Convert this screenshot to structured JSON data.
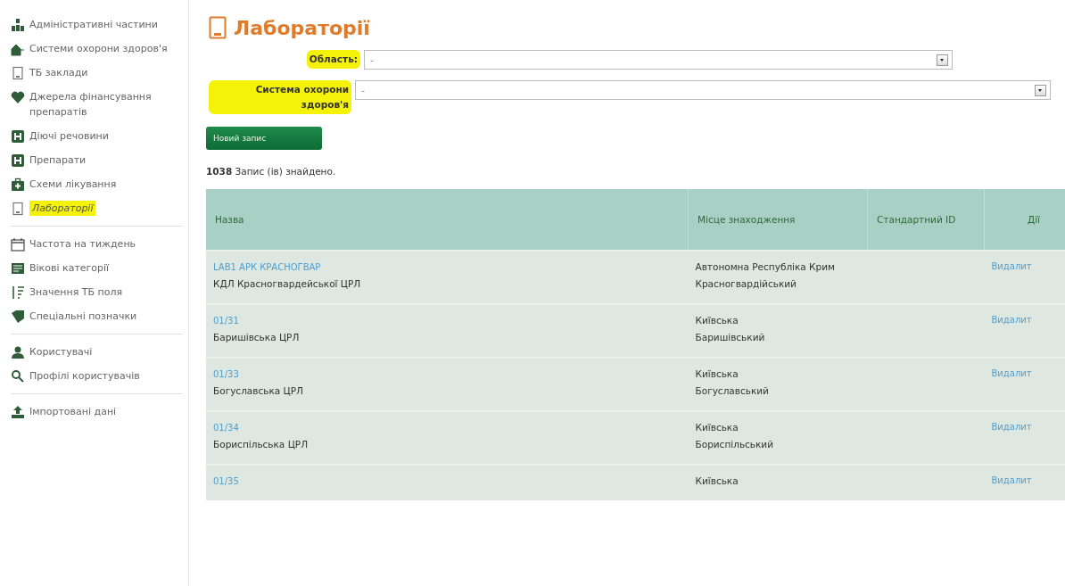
{
  "sidebar": {
    "groups": [
      {
        "items": [
          {
            "label": "Адміністративні частини",
            "selected": false
          },
          {
            "label": "Системи охорони здоров'я",
            "selected": false
          },
          {
            "label": "ТБ заклади",
            "selected": false
          },
          {
            "label": "Джерела фінансування препаратів",
            "selected": false
          },
          {
            "label": "Діючі речовини",
            "selected": false
          },
          {
            "label": "Препарати",
            "selected": false
          },
          {
            "label": "Схеми лікування",
            "selected": false
          },
          {
            "label": "Лабораторії",
            "selected": true
          }
        ]
      },
      {
        "items": [
          {
            "label": "Частота на тиждень",
            "selected": false
          },
          {
            "label": "Вікові категорії",
            "selected": false
          },
          {
            "label": "Значення ТБ поля",
            "selected": false
          },
          {
            "label": "Спеціальні позначки",
            "selected": false
          }
        ]
      },
      {
        "items": [
          {
            "label": "Користувачі",
            "selected": false
          },
          {
            "label": "Профілі користувачів",
            "selected": false
          }
        ]
      },
      {
        "items": [
          {
            "label": "Імпортовані дані",
            "selected": false
          }
        ]
      }
    ]
  },
  "page": {
    "title": "Лабораторії"
  },
  "filters": [
    {
      "label": "Область:",
      "value": "-"
    },
    {
      "label": "Система охорони здоров'я",
      "value": "-"
    }
  ],
  "new_button": "Новий запис",
  "result_count": "**1038** Запис (ів) знайдено.",
  "table": {
    "columns": [
      "Назва",
      "Місце знаходження",
      "Стандартний ID",
      "Дії"
    ],
    "rows": [
      {
        "code": "LAB1 АРК КРАСНОГВАР",
        "name": "КДЛ Красногвардейської ЦРЛ",
        "location": [
          "Автономна Республіка Крим",
          "Красногвардійський"
        ],
        "action": "Видалит"
      },
      {
        "code": "01/31",
        "name": "Баришівська ЦРЛ",
        "location": [
          "Київська",
          "Баришівський"
        ],
        "action": "Видалит"
      },
      {
        "code": "01/33",
        "name": "Богуславська ЦРЛ",
        "location": [
          "Київська",
          "Богуславський"
        ],
        "action": "Видалит"
      },
      {
        "code": "01/34",
        "name": "Бориспільська ЦРЛ",
        "location": [
          "Київська",
          "Бориспільський"
        ],
        "action": "Видалит"
      },
      {
        "code": "01/35",
        "location": [
          "Київська"
        ],
        "action": "Видалит"
      }
    ]
  }
}
